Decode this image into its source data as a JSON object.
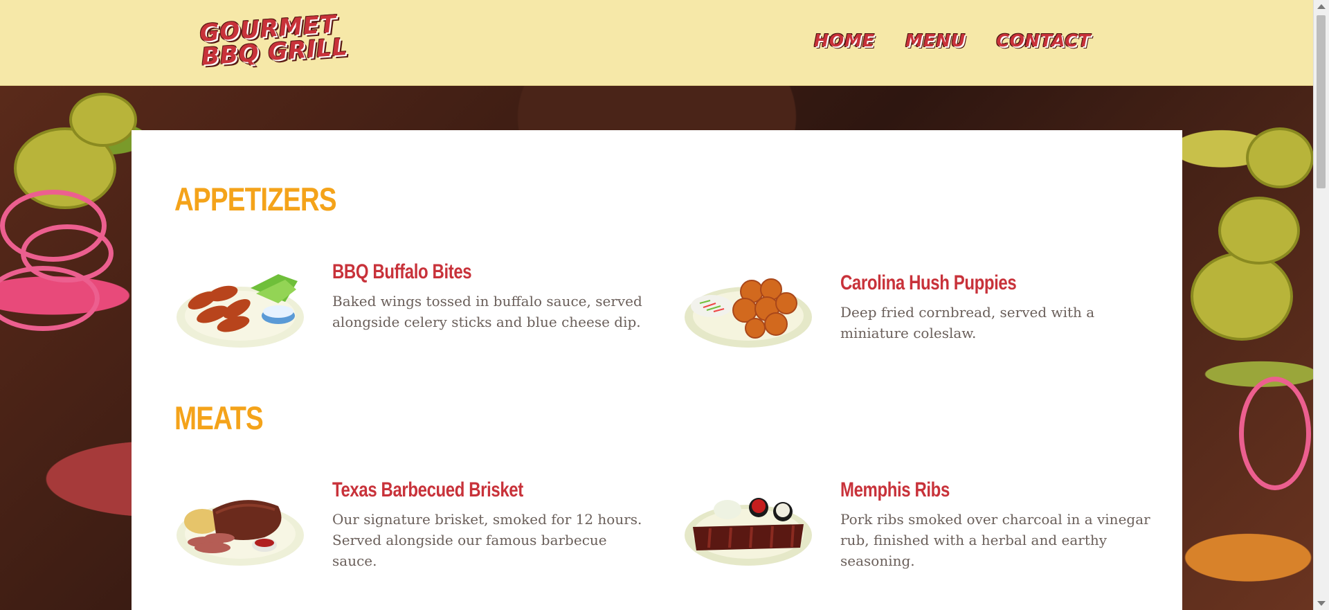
{
  "header": {
    "logo_line1": "GOURMET",
    "logo_line2": "BBQ GRILL",
    "nav": [
      "HOME",
      "MENU",
      "CONTACT"
    ]
  },
  "sections": [
    {
      "title": "APPETIZERS",
      "items": [
        {
          "name": "BBQ Buffalo Bites",
          "description": "Baked wings tossed in buffalo sauce, served alongside celery sticks and blue cheese dip.",
          "icon": "buffalo-wings-plate-icon"
        },
        {
          "name": "Carolina Hush Puppies",
          "description": "Deep fried cornbread, served with a miniature coleslaw.",
          "icon": "hush-puppies-plate-icon"
        }
      ]
    },
    {
      "title": "MEATS",
      "items": [
        {
          "name": "Texas Barbecued Brisket",
          "description": "Our signature brisket, smoked for 12 hours. Served alongside our famous barbecue sauce.",
          "icon": "brisket-plate-icon"
        },
        {
          "name": "Memphis Ribs",
          "description": "Pork ribs smoked over charcoal in a vinegar rub, finished with a herbal and earthy seasoning.",
          "icon": "ribs-plate-icon"
        }
      ]
    }
  ],
  "colors": {
    "header_bg": "#f6e8a8",
    "brand_red": "#c8323a",
    "section_orange": "#f4a31a",
    "body_text": "#6a5f5a"
  }
}
